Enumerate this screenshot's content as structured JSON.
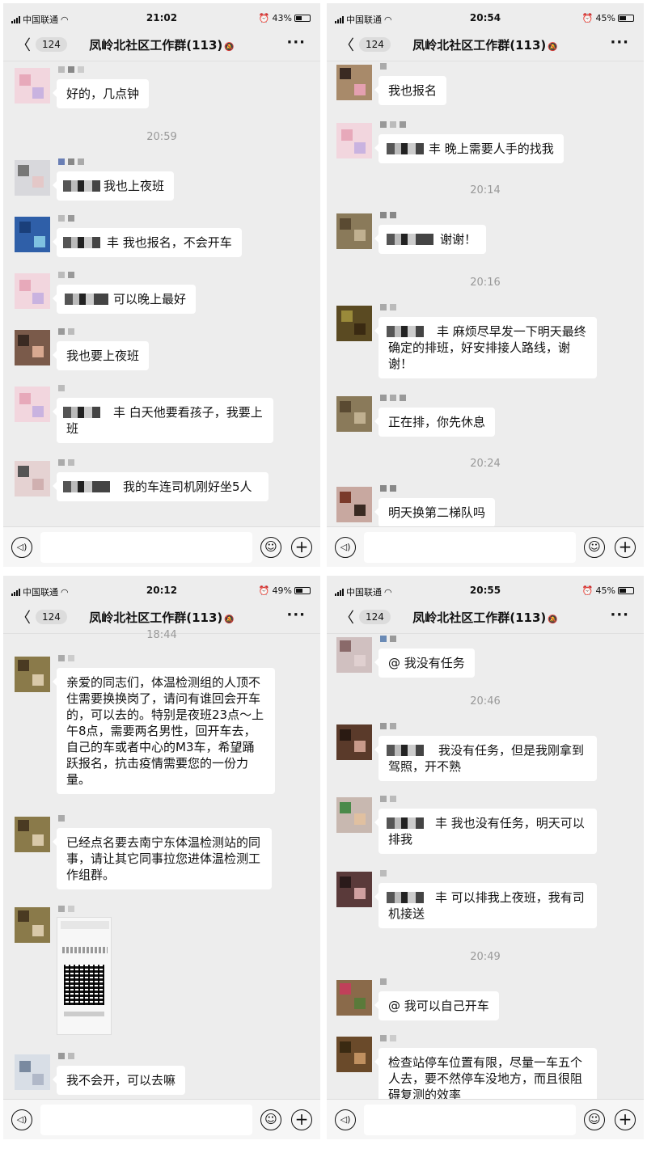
{
  "panels": [
    {
      "status": {
        "carrier": "中国联通",
        "time": "21:02",
        "battery": "43%"
      },
      "nav": {
        "back_count": "124",
        "title": "凤岭北社区工作群(113)"
      },
      "messages": [
        {
          "text": "好的，几点钟"
        },
        {
          "text": "我也上夜班"
        },
        {
          "text": "丰 我也报名，不会开车"
        },
        {
          "text": "可以晚上最好"
        },
        {
          "text": "我也要上夜班"
        },
        {
          "text": "丰 白天他要看孩子，我要上班"
        },
        {
          "text": "我的车连司机刚好坐5人"
        }
      ],
      "timestamps": [
        "20:59"
      ]
    },
    {
      "status": {
        "carrier": "中国联通",
        "time": "20:54",
        "battery": "45%"
      },
      "nav": {
        "back_count": "124",
        "title": "凤岭北社区工作群(113)"
      },
      "messages": [
        {
          "text": "我也报名"
        },
        {
          "text": "丰 晚上需要人手的找我"
        },
        {
          "text": "谢谢！"
        },
        {
          "text": "丰 麻烦尽早发一下明天最终确定的排班，好安排接人路线，谢谢！"
        },
        {
          "text": "正在排，你先休息"
        },
        {
          "text": "明天换第二梯队吗"
        }
      ],
      "timestamps": [
        "20:14",
        "20:16",
        "20:24"
      ]
    },
    {
      "status": {
        "carrier": "中国联通",
        "time": "20:12",
        "battery": "49%"
      },
      "nav": {
        "back_count": "124",
        "title": "凤岭北社区工作群(113)"
      },
      "messages": [
        {
          "text": "亲爱的同志们，体温检测组的人顶不住需要换换岗了，请问有谁回会开车的，可以去的。特别是夜班23点～上午8点，需要两名男性，回开车去，自己的车或者中心的M3车，希望踊跃报名，抗击疫情需要您的一份力量。"
        },
        {
          "text": "已经点名要去南宁东体温检测站的同事，请让其它同事拉您进体温检测工作组群。"
        },
        {
          "text": "我不会开，可以去嘛"
        }
      ],
      "timestamps": [
        "18:44"
      ]
    },
    {
      "status": {
        "carrier": "中国联通",
        "time": "20:55",
        "battery": "45%"
      },
      "nav": {
        "back_count": "124",
        "title": "凤岭北社区工作群(113)"
      },
      "messages": [
        {
          "text": "@ 我没有任务"
        },
        {
          "text": "我没有任务，但是我刚拿到驾照，开不熟"
        },
        {
          "text": "丰 我也没有任务，明天可以排我"
        },
        {
          "text": "丰 可以排我上夜班，我有司机接送"
        },
        {
          "text": "@ 我可以自己开车"
        },
        {
          "text": "检查站停车位置有限，尽量一车五个人去，要不然停车没地方，而且很阻碍复测的效率"
        }
      ],
      "timestamps": [
        "20:46",
        "20:49"
      ]
    }
  ],
  "colors": {
    "background": "#ededed",
    "bubble": "#ffffff",
    "timestamp": "#999999"
  },
  "icons": [
    "signal-icon",
    "wifi-icon",
    "alarm-icon",
    "battery-icon",
    "back-chevron-icon",
    "mute-bell-icon",
    "more-icon",
    "voice-icon",
    "emoji-icon",
    "plus-icon"
  ]
}
